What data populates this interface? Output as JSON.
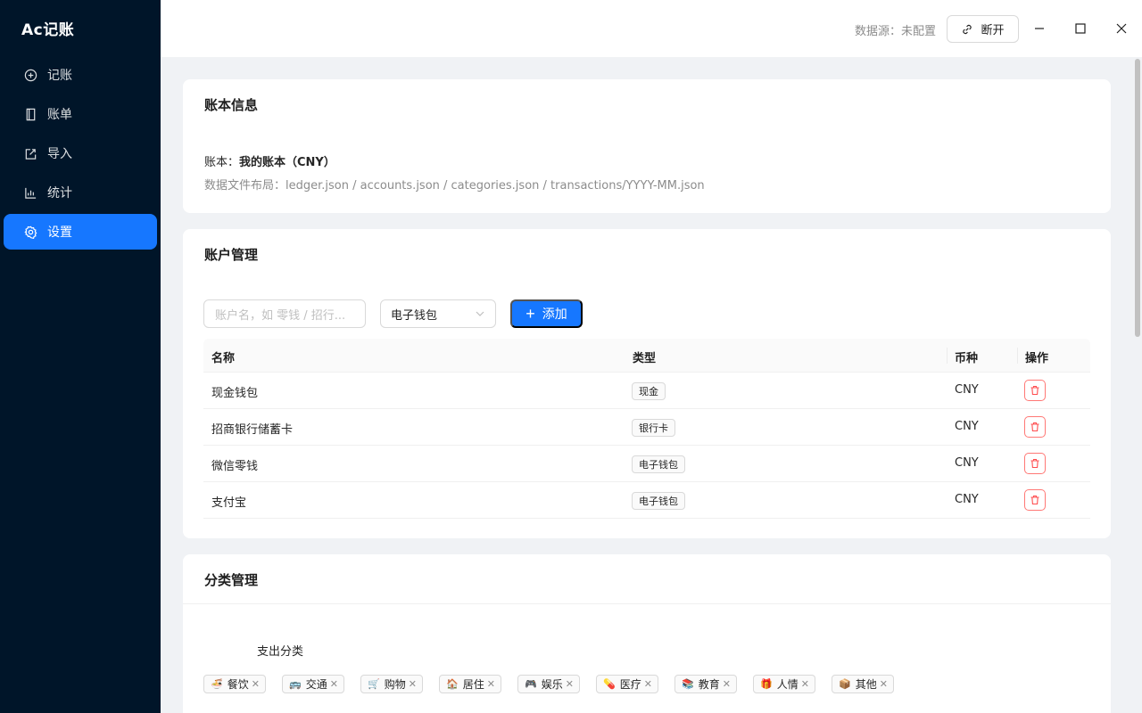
{
  "app": {
    "brand": "Ac记账"
  },
  "sidebar": {
    "items": [
      {
        "label": "记账",
        "icon": "plus-circle-icon",
        "active": false
      },
      {
        "label": "账单",
        "icon": "book-icon",
        "active": false
      },
      {
        "label": "导入",
        "icon": "edit-import-icon",
        "active": false
      },
      {
        "label": "统计",
        "icon": "bar-chart-icon",
        "active": false
      },
      {
        "label": "设置",
        "icon": "gear-icon",
        "active": true
      }
    ]
  },
  "titlebar": {
    "datasource_label": "数据源：未配置",
    "disconnect_label": "断开",
    "window_controls": [
      "minimize-icon",
      "maximize-icon",
      "close-icon"
    ]
  },
  "ledger_card": {
    "title": "账本信息",
    "ledger_prefix": "账本：",
    "ledger_name": "我的账本（CNY）",
    "layout_text": "数据文件布局：ledger.json / accounts.json / categories.json / transactions/YYYY-MM.json"
  },
  "accounts_card": {
    "title": "账户管理",
    "input_placeholder": "账户名，如 零钱 / 招行...",
    "select_value": "电子钱包",
    "add_label": "添加",
    "columns": [
      "名称",
      "类型",
      "币种",
      "操作"
    ],
    "rows": [
      {
        "name": "现金钱包",
        "type": "现金",
        "currency": "CNY"
      },
      {
        "name": "招商银行储蓄卡",
        "type": "银行卡",
        "currency": "CNY"
      },
      {
        "name": "微信零钱",
        "type": "电子钱包",
        "currency": "CNY"
      },
      {
        "name": "支付宝",
        "type": "电子钱包",
        "currency": "CNY"
      }
    ]
  },
  "categories_card": {
    "title": "分类管理",
    "expense_label": "支出分类",
    "expense_tags": [
      {
        "emoji": "🍜",
        "label": "餐饮"
      },
      {
        "emoji": "🚌",
        "label": "交通"
      },
      {
        "emoji": "🛒",
        "label": "购物"
      },
      {
        "emoji": "🏠",
        "label": "居住"
      },
      {
        "emoji": "🎮",
        "label": "娱乐"
      },
      {
        "emoji": "💊",
        "label": "医疗"
      },
      {
        "emoji": "📚",
        "label": "教育"
      },
      {
        "emoji": "🎁",
        "label": "人情"
      },
      {
        "emoji": "📦",
        "label": "其他"
      }
    ]
  },
  "colors": {
    "sidebar_bg": "#001529",
    "accent": "#1677ff",
    "danger": "#ff4d4f",
    "page_bg": "#f0f2f5"
  }
}
